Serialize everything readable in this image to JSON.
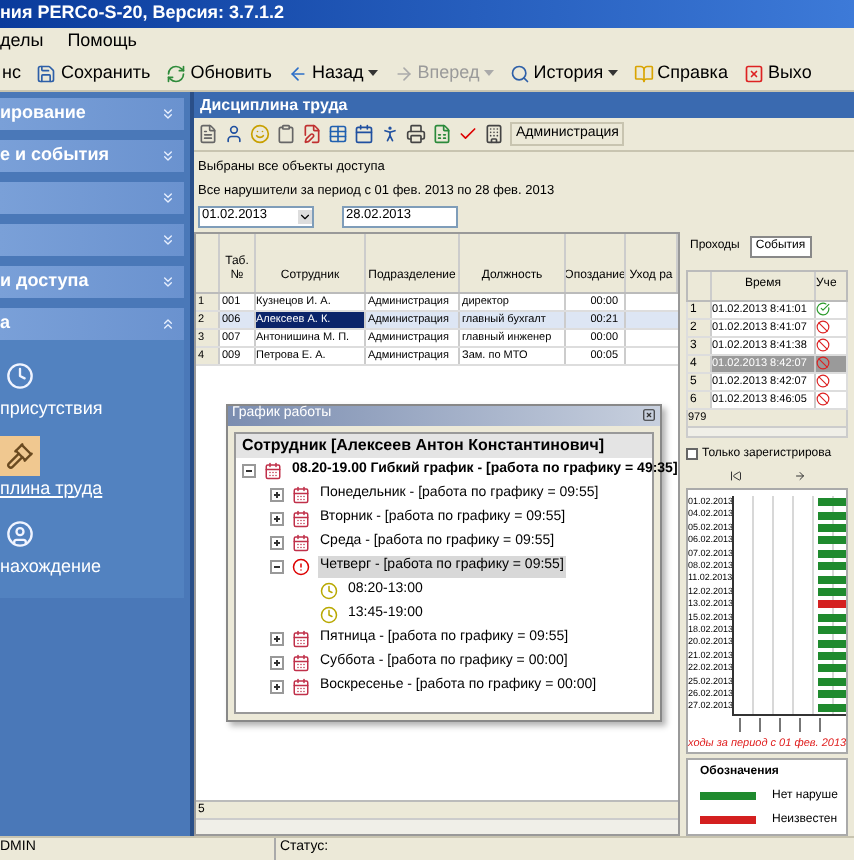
{
  "window": {
    "title": "ния PERCo-S-20, Версия: 3.7.1.2"
  },
  "menu": [
    "делы",
    "Помощь"
  ],
  "toolbar": [
    {
      "label": "нс",
      "kind": "plain",
      "disabled": false,
      "dropdown": false
    },
    {
      "label": "Сохранить",
      "kind": "save",
      "disabled": false,
      "dropdown": false
    },
    {
      "label": "Обновить",
      "kind": "refresh",
      "disabled": false,
      "dropdown": false
    },
    {
      "label": "Назад",
      "kind": "back",
      "disabled": false,
      "dropdown": true
    },
    {
      "label": "Вперед",
      "kind": "forward",
      "disabled": true,
      "dropdown": true
    },
    {
      "label": "История",
      "kind": "history",
      "disabled": false,
      "dropdown": true
    },
    {
      "label": "Справка",
      "kind": "help",
      "disabled": false,
      "dropdown": false
    },
    {
      "label": "Выхо",
      "kind": "exit",
      "disabled": false,
      "dropdown": false
    }
  ],
  "sidebar": {
    "sections": [
      {
        "label": "ирование",
        "expanded": false
      },
      {
        "label": "е и события",
        "expanded": false
      },
      {
        "expanded": false
      },
      {
        "expanded": false
      },
      {
        "label": "и доступа",
        "expanded": false
      },
      {
        "label": "а",
        "expanded": true,
        "items": [
          {
            "label": "присутствия",
            "kind": "clock",
            "selected": false
          },
          {
            "label": "плина труда",
            "kind": "gavel",
            "selected": true
          },
          {
            "label": "нахождение",
            "kind": "person",
            "selected": false
          }
        ]
      }
    ]
  },
  "panel": {
    "title": "Дисциплина труда",
    "admin_button": "Администрация",
    "info": [
      "Выбраны все объекты доступа",
      "Все нарушители за период с 01 фев. 2013  по 28 фев. 2013"
    ],
    "date_from": "01.02.2013",
    "date_to": "28.02.2013"
  },
  "table": {
    "columns": [
      "Таб. №",
      "Сотрудник",
      "Подразделение",
      "Должность",
      "Опоздание",
      "Уход ра"
    ],
    "rows": [
      {
        "n": "1",
        "id": "001",
        "name": "Кузнецов И. А.",
        "dept": "Администрация",
        "position": "директор",
        "late": "00:00",
        "selected": false
      },
      {
        "n": "2",
        "id": "006",
        "name": "Алексеев А. К.",
        "dept": "Администрация",
        "position": "главный бухгалт",
        "late": "00:21",
        "selected": true
      },
      {
        "n": "3",
        "id": "007",
        "name": "Антонишина М. П.",
        "dept": "Администрация",
        "position": "главный инженер",
        "late": "00:00",
        "selected": false
      },
      {
        "n": "4",
        "id": "009",
        "name": "Петрова Е. А.",
        "dept": "Администрация",
        "position": "Зам. по МТО",
        "late": "00:05",
        "selected": false
      }
    ],
    "footer": "5"
  },
  "schedule_window": {
    "title": "График работы",
    "header": "Сотрудник [Алексеев Антон Константинович]",
    "tree": [
      {
        "label": "08.20-19.00 Гибкий график - [работа по графику = 49:35]",
        "kind": "schedule",
        "expanded": true,
        "selected": false,
        "children": [
          {
            "label": "Понедельник - [работа по графику = 09:55]",
            "kind": "day",
            "expanded": false,
            "selected": false
          },
          {
            "label": "Вторник - [работа по графику = 09:55]",
            "kind": "day",
            "expanded": false,
            "selected": false
          },
          {
            "label": "Среда - [работа по графику = 09:55]",
            "kind": "day",
            "expanded": false,
            "selected": false
          },
          {
            "label": "Четверг - [работа по графику = 09:55]",
            "kind": "alert",
            "expanded": true,
            "selected": true,
            "children": [
              {
                "label": "08:20-13:00",
                "kind": "time"
              },
              {
                "label": "13:45-19:00",
                "kind": "time"
              }
            ]
          },
          {
            "label": "Пятница - [работа по графику = 09:55]",
            "kind": "day",
            "expanded": false,
            "selected": false
          },
          {
            "label": "Суббота - [работа по графику = 00:00]",
            "kind": "day",
            "expanded": false,
            "selected": false
          },
          {
            "label": "Воскресенье - [работа по графику = 00:00]",
            "kind": "day",
            "expanded": false,
            "selected": false
          }
        ]
      }
    ]
  },
  "events": {
    "tabs": [
      {
        "label": "Проходы",
        "selected": false
      },
      {
        "label": "События",
        "selected": true
      }
    ],
    "columns": [
      "Время",
      "Уче"
    ],
    "rows": [
      {
        "n": "1",
        "time": "01.02.2013 8:41:01",
        "kind": "ok",
        "selected": false
      },
      {
        "n": "2",
        "time": "01.02.2013 8:41:07",
        "kind": "denied",
        "selected": false
      },
      {
        "n": "3",
        "time": "01.02.2013 8:41:38",
        "kind": "denied",
        "selected": false
      },
      {
        "n": "4",
        "time": "01.02.2013 8:42:07",
        "kind": "denied",
        "selected": true
      },
      {
        "n": "5",
        "time": "01.02.2013 8:42:07",
        "kind": "denied",
        "selected": false
      },
      {
        "n": "6",
        "time": "01.02.2013 8:46:05",
        "kind": "denied",
        "selected": false
      }
    ],
    "count": "979",
    "checkbox": {
      "label": "Только зарегистрирова",
      "checked": false
    },
    "chart_rows": [
      {
        "date": "01.02.2013",
        "color": "#1f8a2e"
      },
      {
        "date": "04.02.2013",
        "color": "#1f8a2e"
      },
      {
        "date": "05.02.2013",
        "color": "#1f8a2e"
      },
      {
        "date": "06.02.2013",
        "color": "#1f8a2e"
      },
      {
        "date": "07.02.2013",
        "color": "#1f8a2e"
      },
      {
        "date": "08.02.2013",
        "color": "#1f8a2e"
      },
      {
        "date": "11.02.2013",
        "color": "#1f8a2e"
      },
      {
        "date": "12.02.2013",
        "color": "#1f8a2e"
      },
      {
        "date": "13.02.2013",
        "color": "#d42020"
      },
      {
        "date": "15.02.2013",
        "color": "#1f8a2e"
      },
      {
        "date": "18.02.2013",
        "color": "#1f8a2e"
      },
      {
        "date": "20.02.2013",
        "color": "#1f8a2e"
      },
      {
        "date": "21.02.2013",
        "color": "#1f8a2e"
      },
      {
        "date": "22.02.2013",
        "color": "#1f8a2e"
      },
      {
        "date": "25.02.2013",
        "color": "#1f8a2e"
      },
      {
        "date": "26.02.2013",
        "color": "#1f8a2e"
      },
      {
        "date": "27.02.2013",
        "color": "#1f8a2e"
      }
    ],
    "caption": "ходы за период с 01 фев. 2013",
    "legend": {
      "title": "Обозначения",
      "items": [
        {
          "label": "Нет наруше",
          "color": "#1f8a2e"
        },
        {
          "label": "Неизвестен",
          "color": "#d42020"
        }
      ]
    }
  },
  "status_bar": {
    "user": "DMIN",
    "status_label": "Статус:"
  }
}
